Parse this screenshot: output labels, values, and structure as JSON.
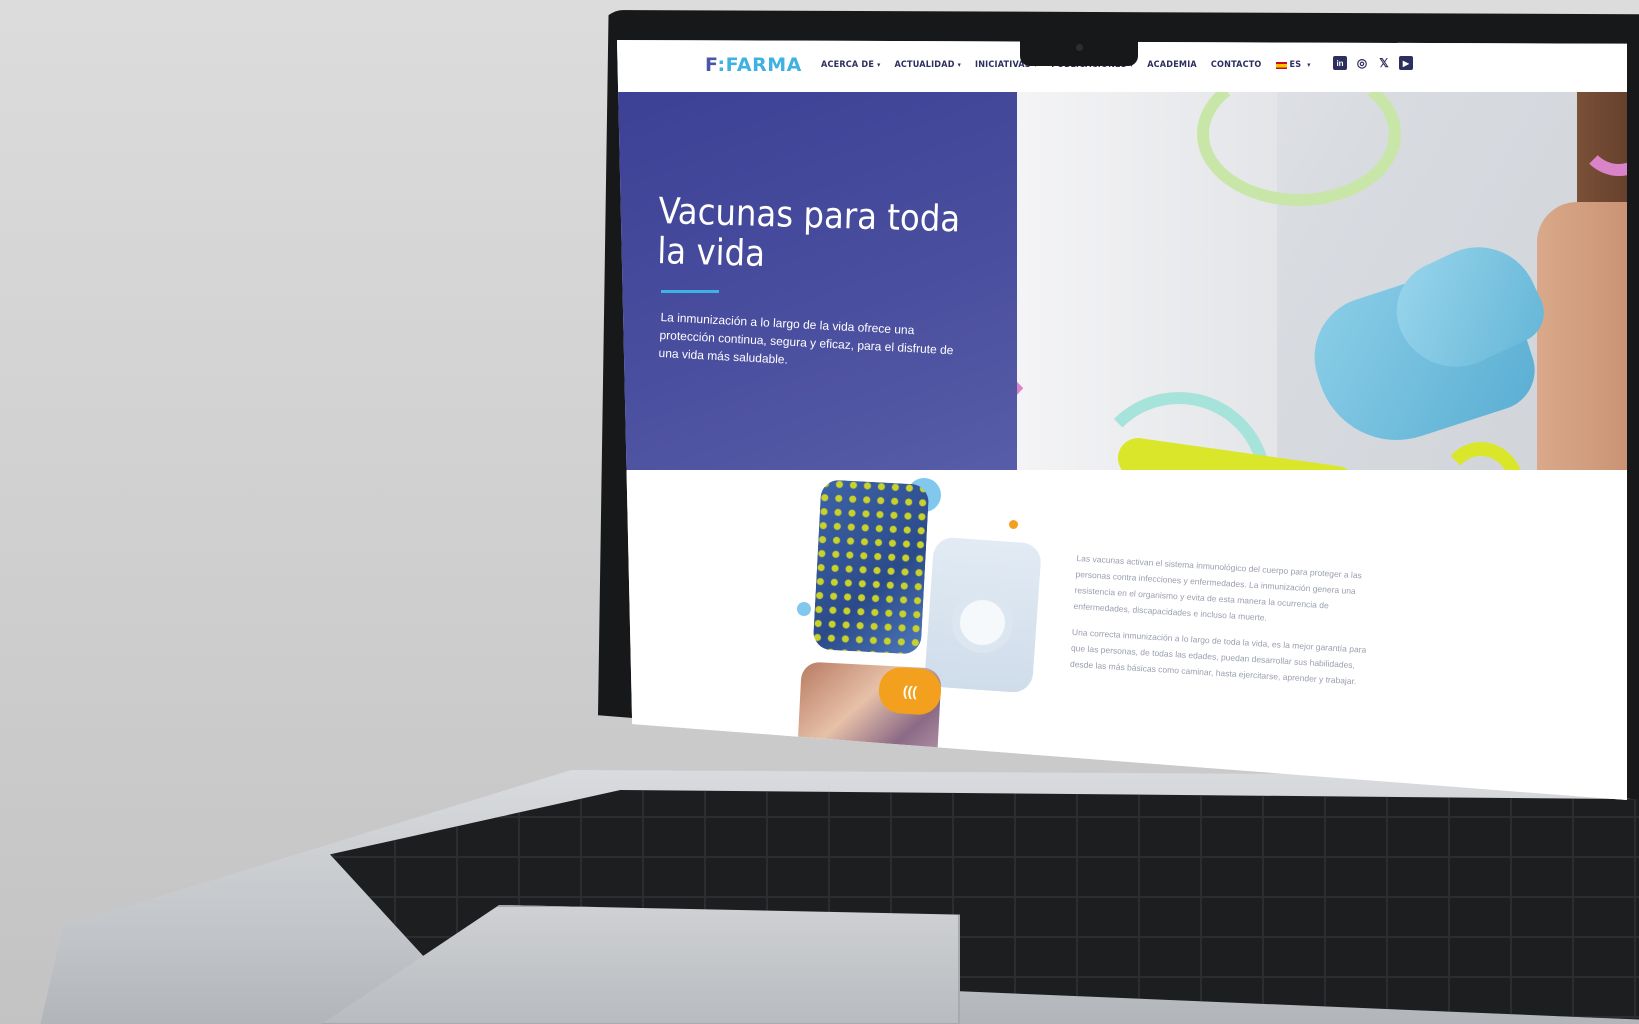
{
  "nav": {
    "logo_prefix": "F",
    "logo_mark": ":",
    "logo_rest": "FARMA",
    "items": [
      {
        "label": "ACERCA DE",
        "dropdown": true
      },
      {
        "label": "ACTUALIDAD",
        "dropdown": true
      },
      {
        "label": "INICIATIVAS",
        "dropdown": true
      },
      {
        "label": "PUBLICACIONES",
        "dropdown": true
      },
      {
        "label": "ACADEMIA",
        "dropdown": false
      },
      {
        "label": "CONTACTO",
        "dropdown": false
      }
    ],
    "language": "ES",
    "social": [
      "linkedin-icon",
      "instagram-icon",
      "x-icon",
      "youtube-icon"
    ]
  },
  "hero": {
    "title": "Vacunas para toda la vida",
    "subtitle": "La inmunización a lo largo de la vida ofrece una protección continua, segura y eficaz, para el disfrute de una vida más saludable."
  },
  "content": {
    "badge": "(((",
    "paragraphs": [
      "Las vacunas activan el sistema inmunológico del cuerpo para proteger a las personas contra infecciones y enfermedades. La inmunización genera una resistencia en el organismo y evita de esta manera la ocurrencia de enfermedades, discapacidades e incluso la muerte.",
      "Una correcta inmunización a lo largo de toda la vida, es la mejor garantía para que las personas, de todas las edades, puedan desarrollar sus habilidades, desde las más básicas como caminar, hasta ejercitarse, aprender y trabajar."
    ]
  },
  "colors": {
    "hero_blue": "#3d4196",
    "accent_cyan": "#3fb1e3",
    "nav_text": "#2d2f5e",
    "badge_orange": "#f2a01e"
  }
}
